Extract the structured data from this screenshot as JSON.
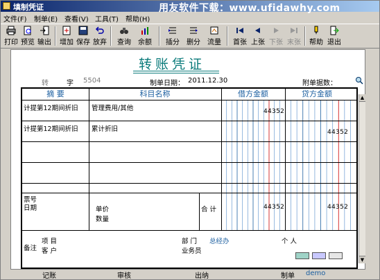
{
  "window": {
    "title": "填制凭证",
    "watermark": "用友软件下载：www.ufidawhy.com"
  },
  "menu": [
    "文件(F)",
    "制单(E)",
    "查看(V)",
    "工具(T)",
    "帮助(H)"
  ],
  "toolbar": {
    "print": "打印",
    "preview": "预览",
    "output": "输出",
    "add": "增加",
    "save": "保存",
    "abandon": "放弃",
    "query": "查询",
    "balance": "余额",
    "insert": "插分",
    "delete": "删分",
    "flow": "流量",
    "first": "首张",
    "prev": "上张",
    "next": "下张",
    "last": "末张",
    "help": "帮助",
    "exit": "退出"
  },
  "voucher": {
    "title": "转账凭证",
    "type": "转",
    "number_label": "字",
    "number": "5504",
    "date_label": "制单日期：",
    "date": "2011.12.30",
    "attach_label": "附单据数：",
    "headers": {
      "summary": "摘  要",
      "account": "科目名称",
      "debit": "借方金额",
      "credit": "贷方金额"
    },
    "rows": [
      {
        "summary": "计提第12期间折旧",
        "account": "管理费用/其他",
        "debit": "44352",
        "credit": ""
      },
      {
        "summary": "计提第12期间折旧",
        "account": "累计折旧",
        "debit": "",
        "credit": "44352"
      }
    ],
    "footer": {
      "bill_no": "票号",
      "date": "日期",
      "unit_price": "单价",
      "quantity": "数量",
      "total_label": "合  计",
      "total_debit": "44352",
      "total_credit": "44352"
    },
    "remarks": {
      "label": "备注",
      "project": "项  目",
      "customer": "客  户",
      "dept_label": "部  门",
      "dept_value": "总经办",
      "personal": "个  人",
      "salesman": "业务员"
    },
    "signoff": {
      "bookkeeping": "记账",
      "audit": "审核",
      "cashier": "出纳",
      "maker_label": "制单",
      "maker": "demo"
    }
  },
  "colors": {
    "title_teal": "#0b7b7b",
    "header_blue": "#1c5fa0",
    "red_line": "#cc0000"
  }
}
